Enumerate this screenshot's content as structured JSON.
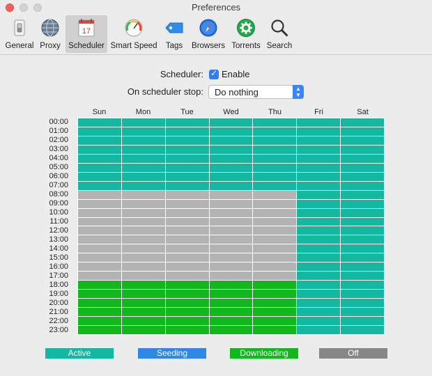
{
  "window": {
    "title": "Preferences"
  },
  "toolbar": {
    "items": [
      {
        "label": "General",
        "icon": "switch-icon"
      },
      {
        "label": "Proxy",
        "icon": "globe-icon"
      },
      {
        "label": "Scheduler",
        "icon": "calendar-icon",
        "day": "17",
        "selected": true
      },
      {
        "label": "Smart Speed",
        "icon": "speedometer-icon"
      },
      {
        "label": "Tags",
        "icon": "tag-icon"
      },
      {
        "label": "Browsers",
        "icon": "compass-icon"
      },
      {
        "label": "Torrents",
        "icon": "gear-icon"
      },
      {
        "label": "Search",
        "icon": "magnifier-icon"
      }
    ]
  },
  "scheduler": {
    "label": "Scheduler:",
    "enable_label": "Enable",
    "enabled": true,
    "stop_label": "On scheduler stop:",
    "stop_value": "Do nothing",
    "days": [
      "Sun",
      "Mon",
      "Tue",
      "Wed",
      "Thu",
      "Fri",
      "Sat"
    ],
    "hours": [
      "00:00",
      "01:00",
      "02:00",
      "03:00",
      "04:00",
      "05:00",
      "06:00",
      "07:00",
      "08:00",
      "09:00",
      "10:00",
      "11:00",
      "12:00",
      "13:00",
      "14:00",
      "15:00",
      "16:00",
      "17:00",
      "18:00",
      "19:00",
      "20:00",
      "21:00",
      "22:00",
      "23:00"
    ],
    "schedule": {
      "Sun": "AAAAAAAAOOOOOOOOOODDDDDD",
      "Mon": "AAAAAAAAOOOOOOOOOODDDDDD",
      "Tue": "AAAAAAAAOOOOOOOOOODDDDDD",
      "Wed": "AAAAAAAAOOOOOOOOOODDDDDD",
      "Thu": "AAAAAAAAOOOOOOOOOODDDDDD",
      "Fri": "AAAAAAAAAAAAAAAAAAAAAAAA",
      "Sat": "AAAAAAAAAAAAAAAAAAAAAAAA"
    }
  },
  "legend": [
    {
      "key": "A",
      "label": "Active",
      "color": "#14b8a0"
    },
    {
      "key": "S",
      "label": "Seeding",
      "color": "#3087e8"
    },
    {
      "key": "D",
      "label": "Downloading",
      "color": "#12b71d"
    },
    {
      "key": "O",
      "label": "Off",
      "color": "#878787"
    }
  ],
  "colors": {
    "off_cell": "#b3b3b3"
  }
}
